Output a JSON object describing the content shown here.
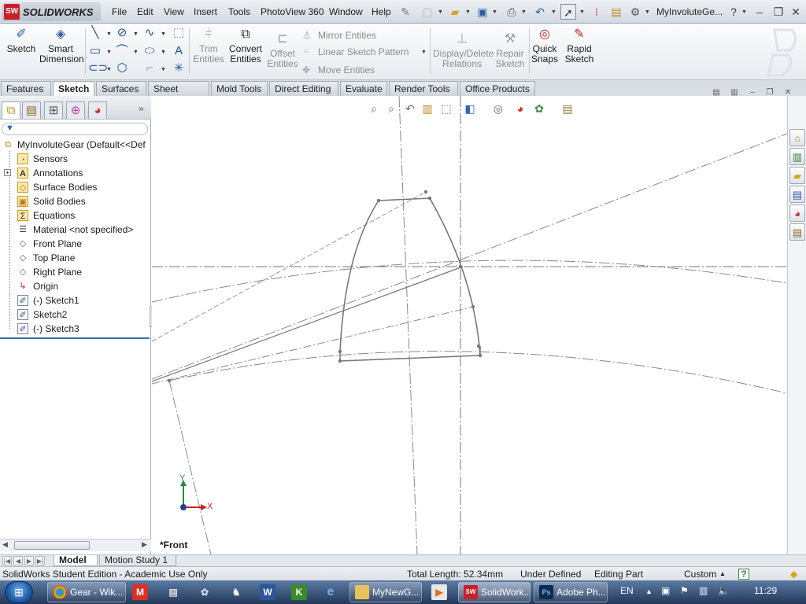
{
  "app": {
    "logo_text": "SOLIDWORKS",
    "document_title": "MyInvoluteGe..."
  },
  "menu": [
    "File",
    "Edit",
    "View",
    "Insert",
    "Tools",
    "PhotoView 360",
    "Window",
    "Help"
  ],
  "ribbon": {
    "sketch": "Sketch",
    "smart_dimension_1": "Smart",
    "smart_dimension_2": "Dimension",
    "trim_1": "Trim",
    "trim_2": "Entities",
    "convert_1": "Convert",
    "convert_2": "Entities",
    "offset_1": "Offset",
    "offset_2": "Entities",
    "mirror": "Mirror Entities",
    "linear_pattern": "Linear Sketch Pattern",
    "move": "Move Entities",
    "display_delete_1": "Display/Delete",
    "display_delete_2": "Relations",
    "repair_1": "Repair",
    "repair_2": "Sketch",
    "quick_snaps_1": "Quick",
    "quick_snaps_2": "Snaps",
    "rapid_sketch_1": "Rapid",
    "rapid_sketch_2": "Sketch"
  },
  "tabs": [
    "Features",
    "Sketch",
    "Surfaces",
    "Sheet Metal",
    "Mold Tools",
    "Direct Editing",
    "Evaluate",
    "Render Tools",
    "Office Products"
  ],
  "active_tab": "Sketch",
  "tree": {
    "root": "MyInvoluteGear  (Default<<Def",
    "items": [
      {
        "label": "Sensors",
        "icon": "sensor-icon"
      },
      {
        "label": "Annotations",
        "icon": "annotations-icon"
      },
      {
        "label": "Surface Bodies",
        "icon": "surface-bodies-icon"
      },
      {
        "label": "Solid Bodies",
        "icon": "solid-bodies-icon"
      },
      {
        "label": "Equations",
        "icon": "equations-icon"
      },
      {
        "label": "Material <not specified>",
        "icon": "material-icon"
      },
      {
        "label": "Front Plane",
        "icon": "plane-icon"
      },
      {
        "label": "Top Plane",
        "icon": "plane-icon"
      },
      {
        "label": "Right Plane",
        "icon": "plane-icon"
      },
      {
        "label": "Origin",
        "icon": "origin-icon"
      },
      {
        "label": "(-) Sketch1",
        "icon": "sketch-icon"
      },
      {
        "label": "Sketch2",
        "icon": "sketch-icon"
      },
      {
        "label": "(-) Sketch3",
        "icon": "sketch-icon"
      }
    ]
  },
  "graphics": {
    "view_name": "*Front",
    "triad_y": "Y",
    "triad_x": "X"
  },
  "bottom_tabs": [
    "Model",
    "Motion Study 1"
  ],
  "status": {
    "edition": "SolidWorks Student Edition - Academic Use Only",
    "total_length": "Total Length: 52.34mm",
    "definition": "Under Defined",
    "mode": "Editing Part",
    "units": "Custom",
    "help": "?"
  },
  "taskbar": {
    "items": [
      {
        "label": "Gear - Wik...",
        "icon": "chrome-icon"
      },
      {
        "label": "MyNewG...",
        "icon": "folder-icon"
      },
      {
        "label": "SolidWork...",
        "icon": "solidworks-icon"
      },
      {
        "label": "Adobe Ph...",
        "icon": "photoshop-icon"
      }
    ],
    "language": "EN",
    "clock": "11:29"
  }
}
